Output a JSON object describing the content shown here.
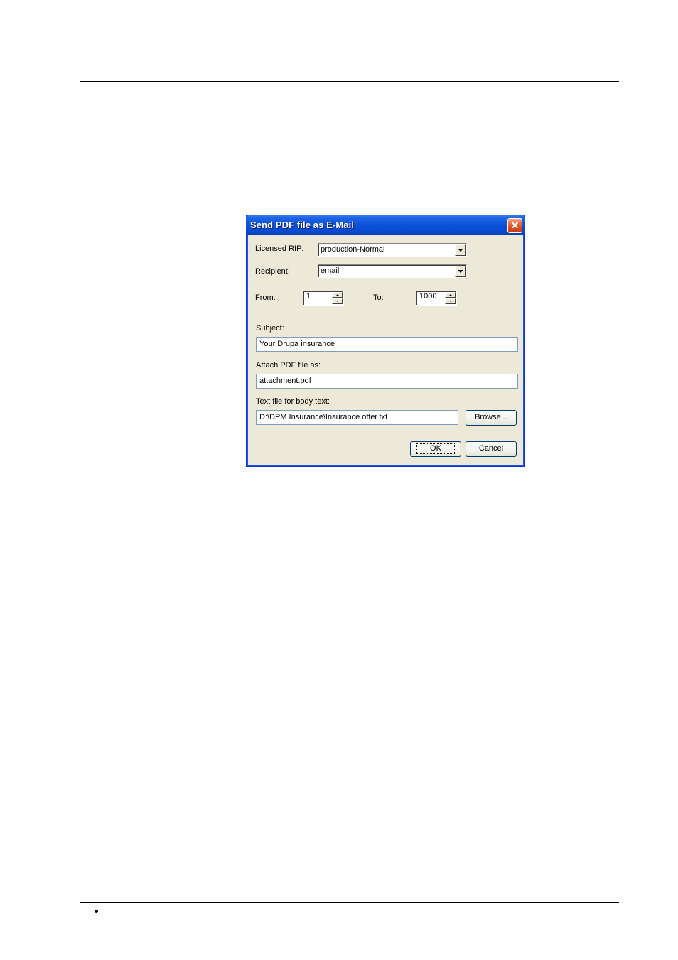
{
  "dialog": {
    "title": "Send PDF file as E-Mail",
    "close_glyph": "✕",
    "licensed_rip": {
      "label": "Licensed RIP:",
      "value": "production-Normal"
    },
    "recipient": {
      "label": "Recipient:",
      "value": "email"
    },
    "from": {
      "label": "From:",
      "value": "1"
    },
    "to": {
      "label": "To:",
      "value": "1000"
    },
    "subject": {
      "label": "Subject:",
      "value": "Your Drupa insurance"
    },
    "attach": {
      "label": "Attach PDF file as:",
      "value": "attachment.pdf"
    },
    "body_text": {
      "label": "Text file for body text:",
      "value": "D:\\DPM Insurance\\Insurance offer.txt"
    },
    "browse_label": "Browse...",
    "ok_label": "OK",
    "cancel_label": "Cancel"
  },
  "colors": {
    "titlebar": "#0a4fd9",
    "dialog_bg": "#ece9d8",
    "close_button": "#e1582f"
  }
}
